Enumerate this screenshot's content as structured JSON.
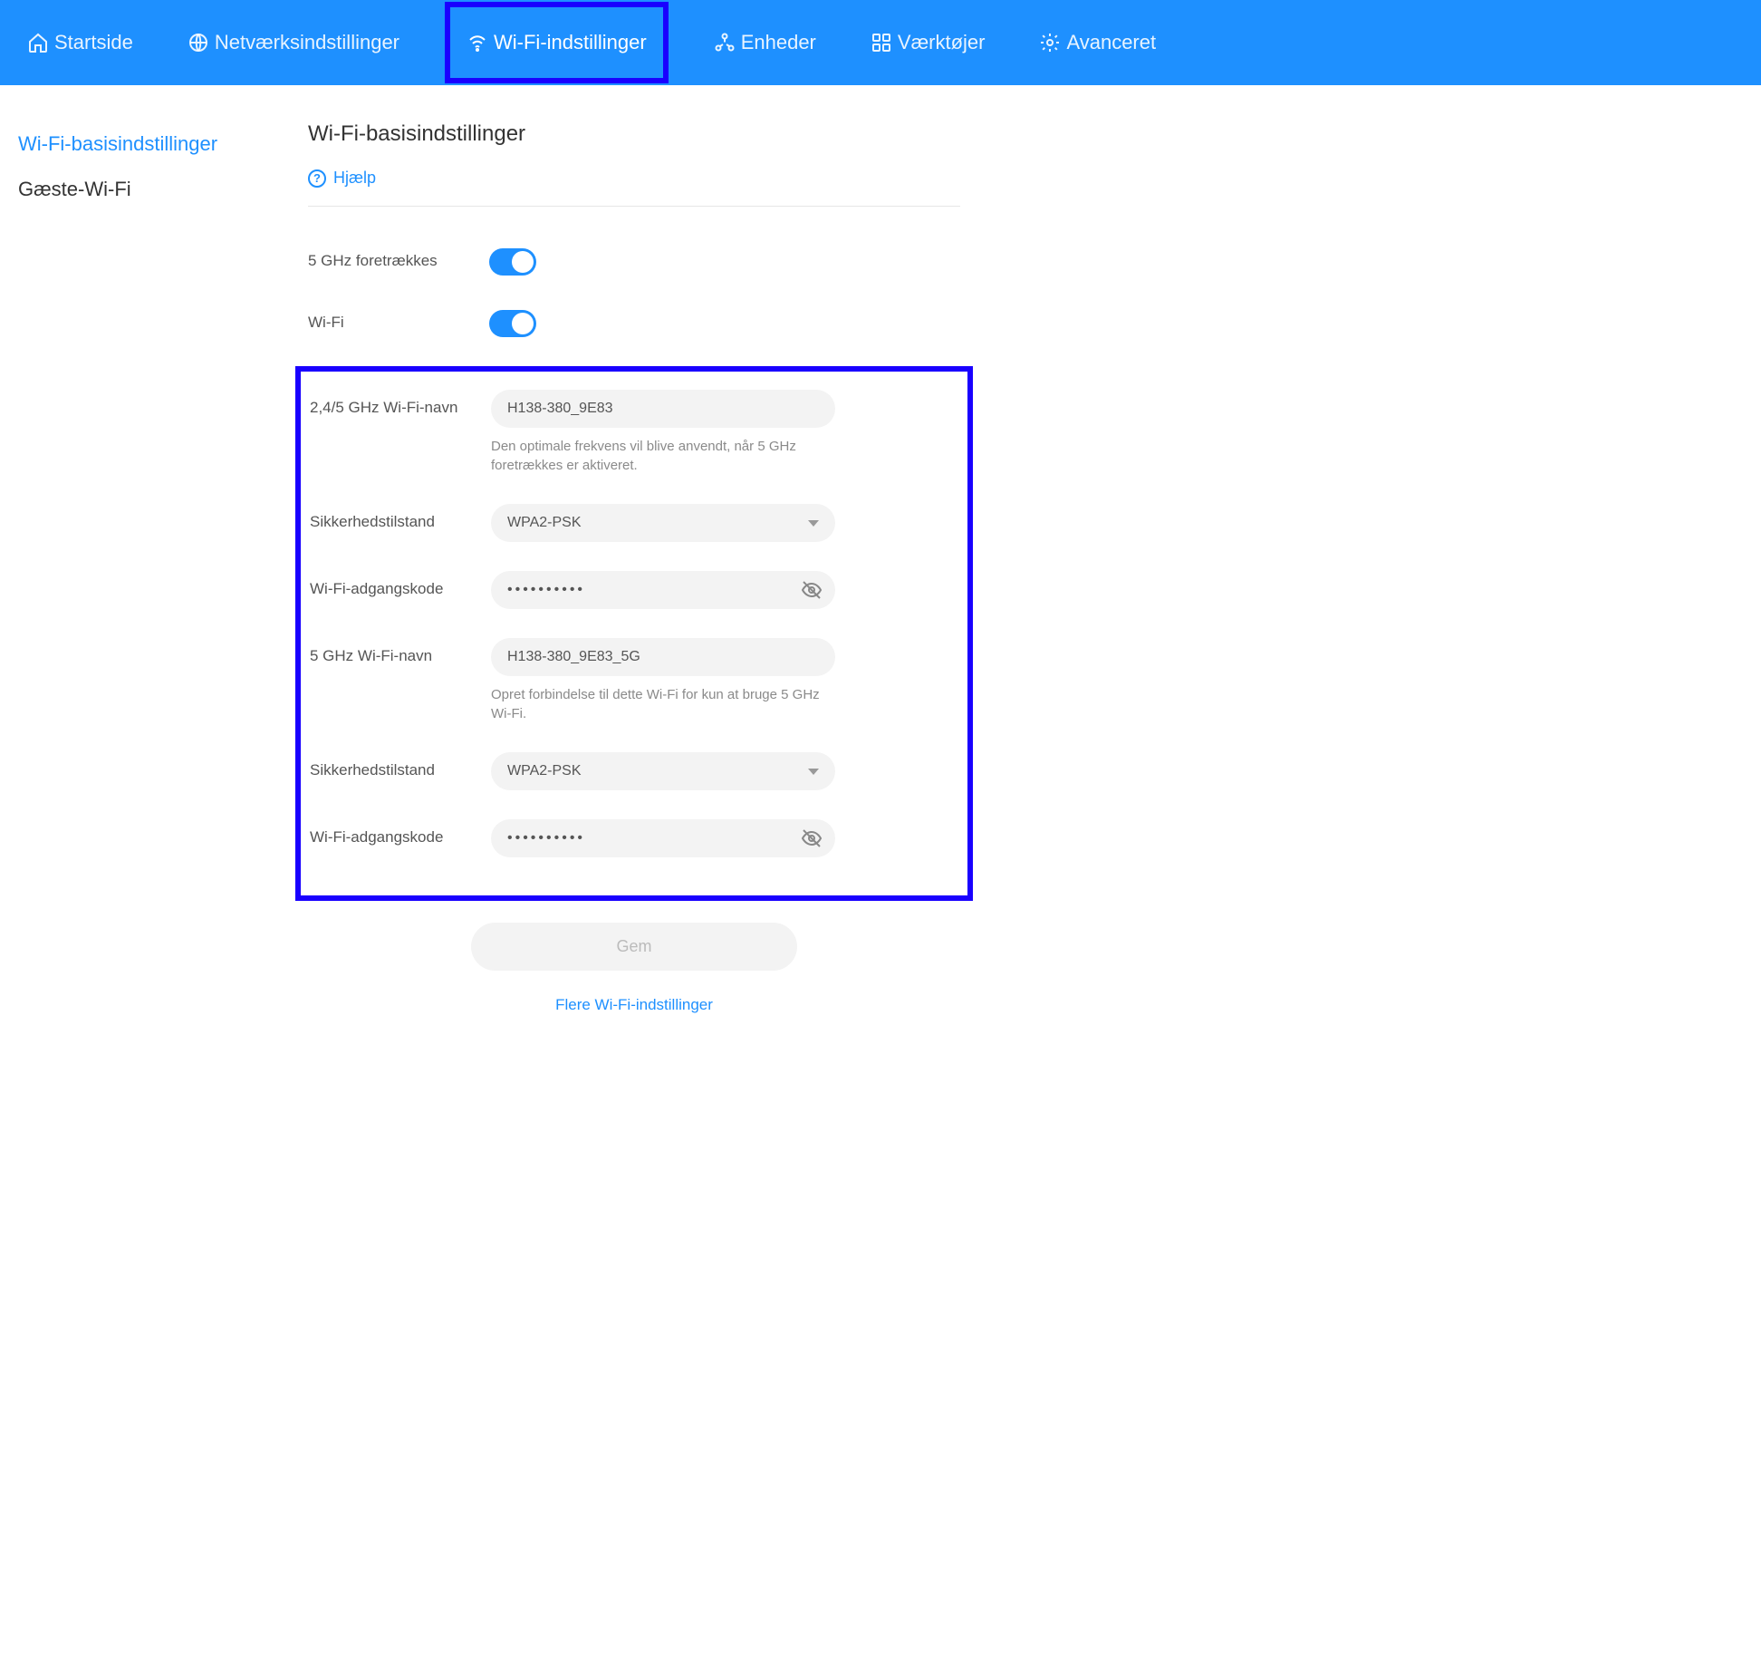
{
  "topnav": {
    "items": [
      {
        "label": "Startside",
        "icon": "home"
      },
      {
        "label": "Netværksindstillinger",
        "icon": "globe"
      },
      {
        "label": "Wi-Fi-indstillinger",
        "icon": "wifi",
        "active": true
      },
      {
        "label": "Enheder",
        "icon": "devices"
      },
      {
        "label": "Værktøjer",
        "icon": "tools"
      },
      {
        "label": "Avanceret",
        "icon": "gear"
      }
    ]
  },
  "sidebar": {
    "items": [
      {
        "label": "Wi-Fi-basisindstillinger",
        "active": true
      },
      {
        "label": "Gæste-Wi-Fi"
      }
    ]
  },
  "main": {
    "title": "Wi-Fi-basisindstillinger",
    "help_label": "Hjælp",
    "rows": {
      "prefer5_label": "5 GHz foretrækkes",
      "wifi_label": "Wi-Fi",
      "name24_label": "2,4/5 GHz Wi-Fi-navn",
      "name24_value": "H138-380_9E83",
      "name24_help": "Den optimale frekvens vil blive anvendt, når 5 GHz foretrækkes er aktiveret.",
      "sec1_label": "Sikkerhedstilstand",
      "sec1_value": "WPA2-PSK",
      "pw1_label": "Wi-Fi-adgangskode",
      "pw1_value": "••••••••••",
      "name5_label": "5 GHz Wi-Fi-navn",
      "name5_value": "H138-380_9E83_5G",
      "name5_help": "Opret forbindelse til dette Wi-Fi for kun at bruge 5 GHz Wi-Fi.",
      "sec2_label": "Sikkerhedstilstand",
      "sec2_value": "WPA2-PSK",
      "pw2_label": "Wi-Fi-adgangskode",
      "pw2_value": "••••••••••"
    },
    "save_label": "Gem",
    "more_label": "Flere Wi-Fi-indstillinger"
  }
}
